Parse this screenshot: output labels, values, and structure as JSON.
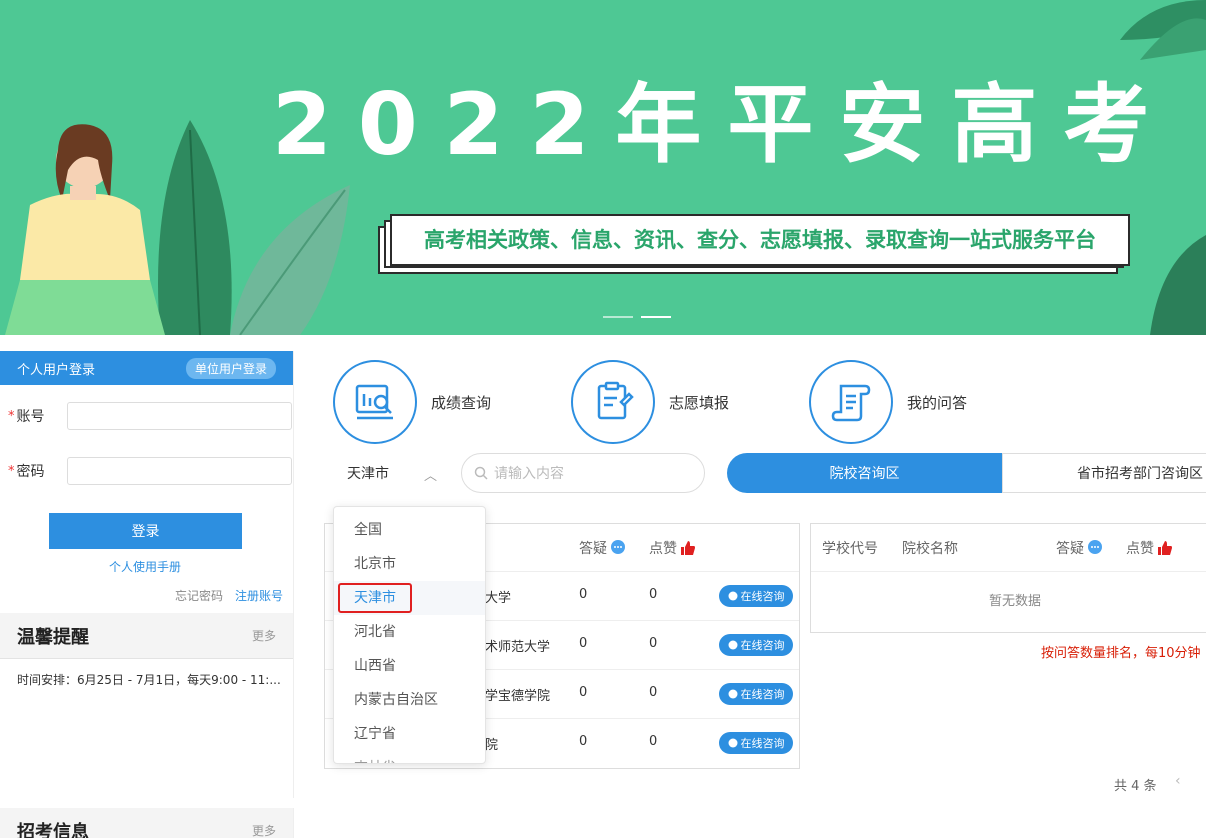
{
  "banner": {
    "title": "2022年平安高考",
    "slogan": "高考相关政策、信息、资讯、查分、志愿填报、录取查询一站式服务平台"
  },
  "login": {
    "tab_personal": "个人用户登录",
    "tab_unit": "单位用户登录",
    "account_label": "账号",
    "password_label": "密码",
    "required_mark": "*",
    "login_button": "登录",
    "manual_link": "个人使用手册",
    "forgot_link": "忘记密码",
    "register_link": "注册账号"
  },
  "notice": {
    "title": "温馨提醒",
    "more": "更多",
    "text": "时间安排：6月25日 - 7月1日，每天9:00 - 11:..."
  },
  "recruit": {
    "title": "招考信息",
    "more": "更多"
  },
  "services": [
    {
      "label": "成绩查询",
      "icon": "score-query-icon"
    },
    {
      "label": "志愿填报",
      "icon": "clipboard-icon"
    },
    {
      "label": "我的问答",
      "icon": "scroll-qa-icon"
    }
  ],
  "filter": {
    "city_selected": "天津市",
    "search_placeholder": "请输入内容",
    "zone_active": "院校咨询区",
    "zone_inactive": "省市招考部门咨询区"
  },
  "table_left": {
    "head_answer": "答疑",
    "head_like": "点赞",
    "consult_label": "在线咨询",
    "rows": [
      {
        "name": "大学",
        "answers": "0",
        "likes": "0"
      },
      {
        "name": "术师范大学",
        "answers": "0",
        "likes": "0"
      },
      {
        "name": "学宝德学院",
        "answers": "0",
        "likes": "0"
      },
      {
        "name": "院",
        "answers": "0",
        "likes": "0"
      }
    ]
  },
  "table_right": {
    "head_code": "学校代号",
    "head_name": "院校名称",
    "head_answer": "答疑",
    "head_like": "点赞",
    "empty": "暂无数据"
  },
  "rank_note": "按问答数量排名，每10分钟",
  "pagination": {
    "total": "共 4 条"
  },
  "dropdown": {
    "options": [
      "全国",
      "北京市",
      "天津市",
      "河北省",
      "山西省",
      "内蒙古自治区",
      "辽宁省",
      "吉林省"
    ],
    "selected": "天津市"
  },
  "colors": {
    "accent": "#2d8fe0",
    "banner": "#4ec894",
    "alert": "#d81e06"
  }
}
